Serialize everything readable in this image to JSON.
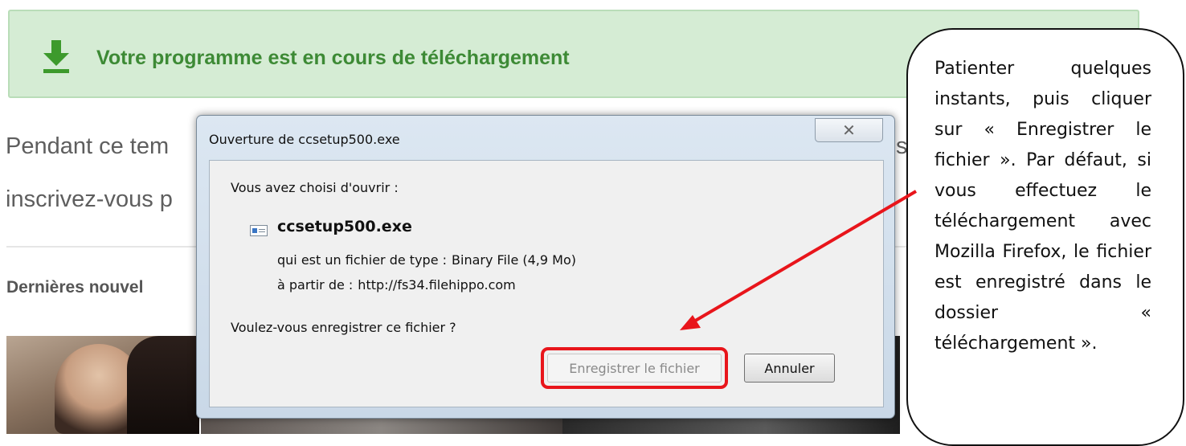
{
  "banner": {
    "icon": "download-icon",
    "text": "Votre programme est en cours de téléchargement",
    "color": "#3d8a35"
  },
  "page": {
    "line1": "Pendant ce tem",
    "line1_right": "s",
    "line2": "inscrivez-vous p",
    "news_heading": "Dernières nouvel"
  },
  "dialog": {
    "title": "Ouverture de ccsetup500.exe",
    "close_symbol": "✕",
    "chose_text": "Vous avez choisi d'ouvrir :",
    "file_icon": "file-icon",
    "filename": "ccsetup500.exe",
    "type_label": "qui est un fichier de type :",
    "type_value": "Binary File (4,9 Mo)",
    "from_label": "à partir de :",
    "from_value": "http://fs34.filehippo.com",
    "question": "Voulez-vous enregistrer ce fichier ?",
    "save_label": "Enregistrer le fichier",
    "cancel_label": "Annuler"
  },
  "callout": {
    "text": "Patienter quelques instants, puis cliquer sur « Enregistrer le fichier ». Par défaut, si vous effectuez le téléchargement avec Mozilla Firefox, le fichier est enregistré dans le dossier « téléchargement ».",
    "arrow_color": "#e8151b"
  }
}
